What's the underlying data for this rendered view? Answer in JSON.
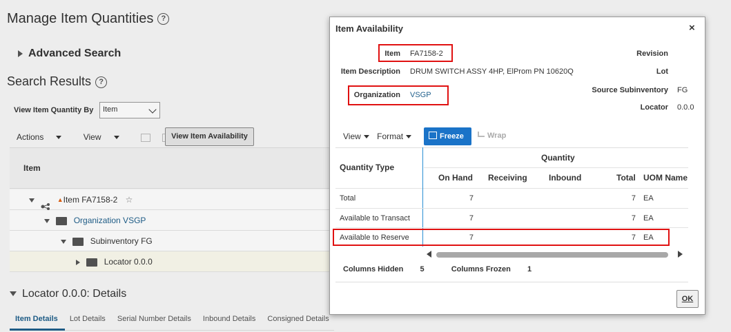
{
  "page": {
    "title": "Manage Item Quantities",
    "help_icon": "?",
    "advanced_search": "Advanced Search",
    "search_results": "Search Results",
    "view_by_label": "View Item Quantity By",
    "view_by_value": "Item",
    "actions_menu": "Actions",
    "view_menu": "View",
    "view_item_availability_button": "View Item Availability",
    "table_header_item": "Item",
    "tree": [
      {
        "label": "Item FA7158-2"
      },
      {
        "label": "Organization VSGP"
      },
      {
        "label": "Subinventory FG"
      },
      {
        "label": "Locator 0.0.0"
      }
    ],
    "locator_details": "Locator 0.0.0: Details",
    "detail_tabs": [
      "Item Details",
      "Lot Details",
      "Serial Number Details",
      "Inbound Details",
      "Consigned Details"
    ]
  },
  "dialog": {
    "title": "Item Availability",
    "close_label": "×",
    "fields": {
      "item_label": "Item",
      "item_value": "FA7158-2",
      "item_description_label": "Item Description",
      "item_description_value": "DRUM SWITCH ASSY 4HP, ElProm PN 10620Q",
      "organization_label": "Organization",
      "organization_value": "VSGP",
      "revision_label": "Revision",
      "lot_label": "Lot",
      "source_subinventory_label": "Source Subinventory",
      "source_subinventory_value": "FG",
      "locator_label": "Locator",
      "locator_value": "0.0.0"
    },
    "toolbar": {
      "view": "View",
      "format": "Format",
      "freeze": "Freeze",
      "wrap": "Wrap"
    },
    "table": {
      "quantity_type_header": "Quantity Type",
      "quantity_group_header": "Quantity",
      "columns": [
        "On Hand",
        "Receiving",
        "Inbound",
        "Total",
        "UOM Name"
      ],
      "rows": [
        {
          "type": "Total",
          "on_hand": "7",
          "total": "7",
          "uom": "EA"
        },
        {
          "type": "Available to Transact",
          "on_hand": "7",
          "total": "7",
          "uom": "EA"
        },
        {
          "type": "Available to Reserve",
          "on_hand": "7",
          "total": "7",
          "uom": "EA"
        }
      ]
    },
    "footer": {
      "columns_hidden_label": "Columns Hidden",
      "columns_hidden_value": "5",
      "columns_frozen_label": "Columns Frozen",
      "columns_frozen_value": "1"
    },
    "ok_button": "OK",
    "highlight_color": "#e01010"
  }
}
